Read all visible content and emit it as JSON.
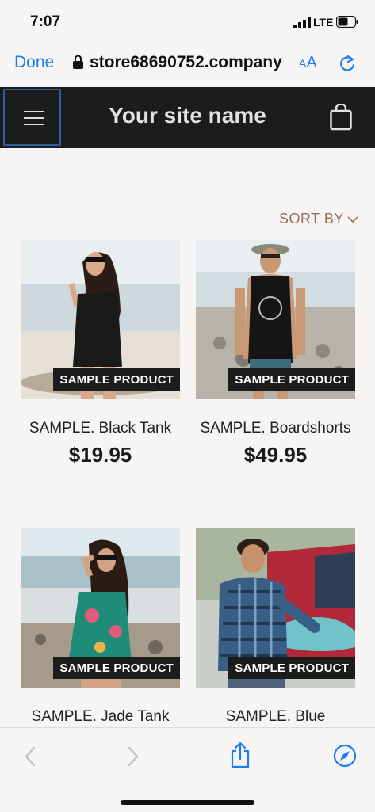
{
  "status_bar": {
    "time": "7:07",
    "network": "LTE",
    "signal_icon": "signal-bars-icon",
    "battery_icon": "battery-icon"
  },
  "browser": {
    "done_label": "Done",
    "url": "store68690752.company",
    "text_size_label_small": "A",
    "text_size_label_large": "A",
    "lock_icon": "lock-icon",
    "reload_icon": "reload-icon"
  },
  "site_header": {
    "title": "Your site name",
    "menu_icon": "hamburger-menu-icon",
    "cart_icon": "shopping-bag-icon"
  },
  "sort": {
    "label": "SORT BY",
    "icon": "chevron-down-icon"
  },
  "products": [
    {
      "name": "SAMPLE. Black Tank",
      "price": "$19.95",
      "badge": "SAMPLE PRODUCT"
    },
    {
      "name": "SAMPLE. Boardshorts",
      "price": "$49.95",
      "badge": "SAMPLE PRODUCT"
    },
    {
      "name": "SAMPLE. Jade Tank",
      "price": "",
      "badge": "SAMPLE PRODUCT"
    },
    {
      "name": "SAMPLE. Blue",
      "price": "",
      "badge": "SAMPLE PRODUCT"
    }
  ],
  "toolbar": {
    "back_icon": "back-arrow-icon",
    "forward_icon": "forward-arrow-icon",
    "share_icon": "share-icon",
    "compass_icon": "safari-compass-icon"
  },
  "colors": {
    "accent": "#1e7cf2",
    "header_bg": "#1c1c1c",
    "sort_color": "#9a6c5a",
    "page_bg": "#f7f5f3"
  }
}
